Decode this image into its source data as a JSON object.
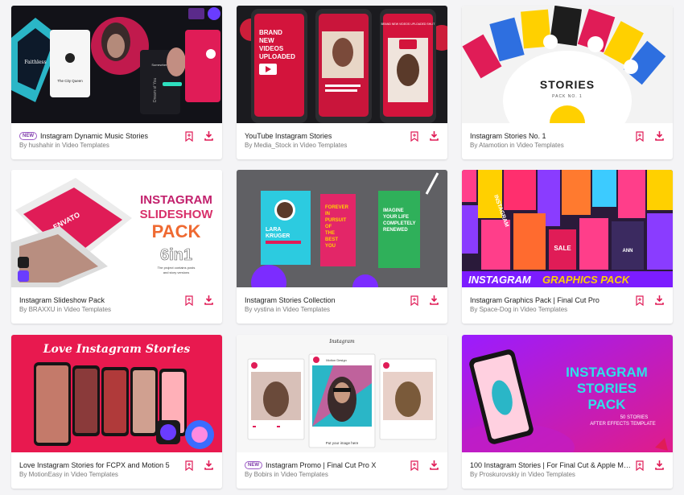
{
  "colors": {
    "accent": "#e01c57",
    "card_bg": "#ffffff",
    "page_bg": "#f4f4f6"
  },
  "icons": {
    "bookmark": "bookmark-add-icon",
    "download": "download-icon"
  },
  "items": [
    {
      "title": "Instagram Dynamic Music Stories",
      "by": "By",
      "author": "hushahir",
      "in": "in",
      "category": "Video Templates",
      "badge": "NEW",
      "thumb": {
        "t1": "Faithless",
        "t2": "The City Queen",
        "t3": "Dream of You",
        "t4": "Somewhere"
      }
    },
    {
      "title": "YouTube Instagram Stories",
      "by": "By",
      "author": "Media_Stock",
      "in": "in",
      "category": "Video Templates",
      "thumb": {
        "t1": "BRAND",
        "t2": "NEW",
        "t3": "VIDEOS",
        "t4": "UPLOADED",
        "t5": "BRAND NEW VIDEOS UPLOADED SHLIT"
      }
    },
    {
      "title": "Instagram Stories No. 1",
      "by": "By",
      "author": "Atamotion",
      "in": "in",
      "category": "Video Templates",
      "thumb": {
        "t1": "STORIES",
        "t2": "PACK NO. 1"
      }
    },
    {
      "title": "Instagram Slideshow Pack",
      "by": "By",
      "author": "BRAXXU",
      "in": "in",
      "category": "Video Templates",
      "thumb": {
        "t1": "INSTAGRAM",
        "t2": "SLIDESHOW",
        "t3": "PACK",
        "t4": "6in1",
        "t5": "The project contains posts",
        "t6": "and story versions",
        "t7": "ENVATO"
      }
    },
    {
      "title": "Instagram Stories Collection",
      "by": "By",
      "author": "vystina",
      "in": "in",
      "category": "Video Templates",
      "thumb": {
        "t1": "LARA",
        "t2": "KRUGER",
        "t3": "FOREVER",
        "t4": "IN",
        "t5": "PURSUIT",
        "t6": "OF",
        "t7": "THE",
        "t8": "BEST",
        "t9": "YOU",
        "t10": "IMAGINE",
        "t11": "YOUR LIFE",
        "t12": "COMPLETELY",
        "t13": "RENEWED"
      }
    },
    {
      "title": "Instagram Graphics Pack | Final Cut Pro",
      "by": "By",
      "author": "Space-Dog",
      "in": "in",
      "category": "Video Templates",
      "thumb": {
        "t1": "INSTAGRAM",
        "t2": "GRAPHICS PACK",
        "t3": "SALE",
        "t4": "INSTAGRAM",
        "t5": "ANN"
      }
    },
    {
      "title": "Love Instagram Stories for FCPX and Motion 5",
      "by": "By",
      "author": "MotionEasy",
      "in": "in",
      "category": "Video Templates",
      "thumb": {
        "t1": "Love Instagram Stories"
      }
    },
    {
      "title": "Instagram Promo | Final Cut Pro X",
      "by": "By",
      "author": "Bobirs",
      "in": "in",
      "category": "Video Templates",
      "badge": "NEW",
      "thumb": {
        "t1": "Instagram",
        "t2": "Put your image here",
        "t3": "Motion Design"
      }
    },
    {
      "title": "100 Instagram Stories | For Final Cut & Apple Mot...",
      "by": "By",
      "author": "Proskurovskiy",
      "in": "in",
      "category": "Video Templates",
      "thumb": {
        "t1": "INSTAGRAM",
        "t2": "STORIES",
        "t3": "PACK",
        "t4": "50 STORIES",
        "t5": "AFTER EFFECTS TEMPLATE"
      }
    }
  ]
}
